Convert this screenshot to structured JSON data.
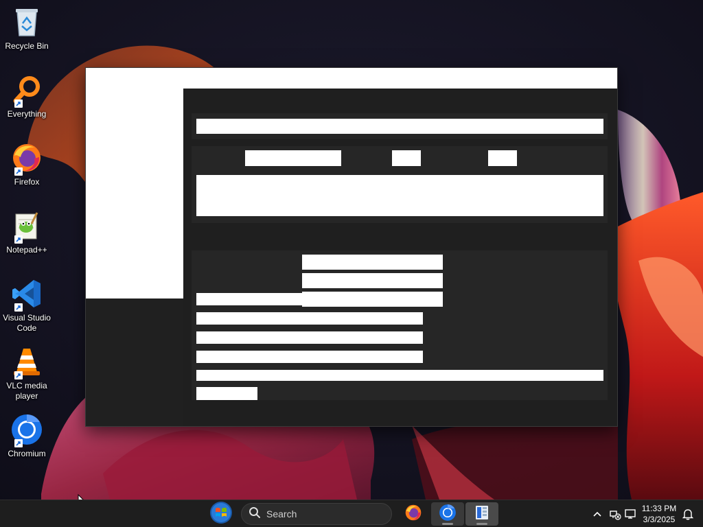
{
  "desktop": {
    "icons": [
      {
        "label": "Recycle Bin",
        "icon": "recycle-bin-icon"
      },
      {
        "label": "Everything",
        "icon": "magnifier-icon"
      },
      {
        "label": "Firefox",
        "icon": "firefox-icon"
      },
      {
        "label": "Notepad++",
        "icon": "notepad-plus-plus-icon"
      },
      {
        "label": "Visual Studio Code",
        "icon": "vscode-icon"
      },
      {
        "label": "VLC media player",
        "icon": "vlc-cone-icon"
      },
      {
        "label": "Chromium",
        "icon": "chromium-icon"
      }
    ]
  },
  "taskbar": {
    "search_label": "Search",
    "pinned": [
      "windows-start-icon",
      "firefox-icon",
      "chromium-icon",
      "file-explorer-app-icon"
    ],
    "tray": [
      "chevron-up-icon",
      "network-icon",
      "display-icon",
      "notification-bell-icon"
    ],
    "clock": {
      "time": "11:33 PM",
      "date": "3/3/2025"
    }
  },
  "colors": {
    "window_bg": "#202020",
    "section_bg": "#262626",
    "placeholder": "#ffffff",
    "taskbar_bg": "#1e1e1e",
    "chromium_blue": "#1a73e8"
  }
}
